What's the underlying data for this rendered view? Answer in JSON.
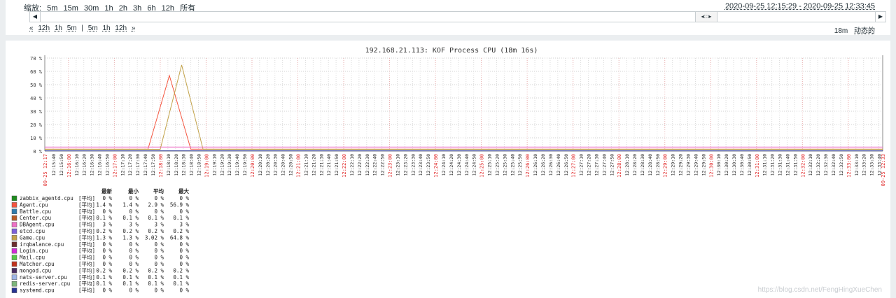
{
  "zoom": {
    "label": "缩放:",
    "options": [
      "5m",
      "15m",
      "30m",
      "1h",
      "2h",
      "3h",
      "6h",
      "12h",
      "所有"
    ]
  },
  "time_range": "2020-09-25 12:15:29 - 2020-09-25 12:33:45",
  "scrollbar": {
    "left_arrow": "◀",
    "right_arrow": "▶",
    "thumb": "◂:::▸"
  },
  "nav": {
    "back_fast": "«",
    "back_items": [
      "12h",
      "1h",
      "5m"
    ],
    "separator": "|",
    "fwd_items": [
      "5m",
      "1h",
      "12h"
    ],
    "fwd_fast": "»"
  },
  "period": {
    "length": "18m",
    "mode": "动态的"
  },
  "graph": {
    "title": "192.168.21.113: KOF Process CPU (18m 16s)",
    "colors": {
      "Agent": "#f4553f",
      "Game": "#c2a24a",
      "baseline": "#1a237e"
    }
  },
  "chart_data": {
    "type": "line",
    "title": "192.168.21.113: KOF Process CPU (18m 16s)",
    "ylim": [
      0,
      70
    ],
    "yticks": [
      "0 %",
      "10 %",
      "20 %",
      "30 %",
      "40 %",
      "50 %",
      "60 %",
      "70 %"
    ],
    "x_start_label": "09-25 12:17",
    "x_end_label": "09-25 12:33",
    "x_time_labels": [
      "12:15:40",
      "12:15:50",
      "12:16:00",
      "12:16:10",
      "12:16:20",
      "12:16:30",
      "12:16:40",
      "12:16:50",
      "12:17:00",
      "12:17:10",
      "12:17:20",
      "12:17:30",
      "12:17:40",
      "12:17:50",
      "12:18:00",
      "12:18:10",
      "12:18:20",
      "12:18:30",
      "12:18:40",
      "12:18:50",
      "12:19:00",
      "12:19:10",
      "12:19:20",
      "12:19:30",
      "12:19:40",
      "12:19:50",
      "12:20:00",
      "12:20:10",
      "12:20:20",
      "12:20:30",
      "12:20:40",
      "12:20:50",
      "12:21:00",
      "12:21:10",
      "12:21:20",
      "12:21:30",
      "12:21:40",
      "12:21:50",
      "12:22:00",
      "12:22:10",
      "12:22:20",
      "12:22:30",
      "12:22:40",
      "12:22:50",
      "12:23:00",
      "12:23:10",
      "12:23:20",
      "12:23:30",
      "12:23:40",
      "12:23:50",
      "12:24:00",
      "12:24:10",
      "12:24:20",
      "12:24:30",
      "12:24:40",
      "12:24:50",
      "12:25:00",
      "12:25:10",
      "12:25:20",
      "12:25:30",
      "12:25:40",
      "12:25:50",
      "12:26:00",
      "12:26:10",
      "12:26:20",
      "12:26:30",
      "12:26:40",
      "12:26:50",
      "12:27:00",
      "12:27:10",
      "12:27:20",
      "12:27:30",
      "12:27:40",
      "12:27:50",
      "12:28:00",
      "12:28:10",
      "12:28:20",
      "12:28:30",
      "12:28:40",
      "12:28:50",
      "12:29:00",
      "12:29:10",
      "12:29:20",
      "12:29:30",
      "12:29:40",
      "12:29:50",
      "12:30:00",
      "12:30:10",
      "12:30:20",
      "12:30:30",
      "12:30:40",
      "12:30:50",
      "12:31:00",
      "12:31:10",
      "12:31:20",
      "12:31:30",
      "12:31:40",
      "12:31:50",
      "12:32:00",
      "12:32:10",
      "12:32:20",
      "12:32:30",
      "12:32:40",
      "12:32:50",
      "12:33:00",
      "12:33:10",
      "12:33:20",
      "12:33:30",
      "12:33:40"
    ],
    "series": [
      {
        "name": "Agent.cpu",
        "color": "#f4553f",
        "points": [
          [
            "12:15:29",
            1.4
          ],
          [
            "12:17:44",
            1.4
          ],
          [
            "12:18:12",
            56.9
          ],
          [
            "12:18:40",
            1.4
          ],
          [
            "12:33:45",
            1.4
          ]
        ]
      },
      {
        "name": "Game.cpu",
        "color": "#c2a24a",
        "points": [
          [
            "12:15:29",
            1.3
          ],
          [
            "12:18:00",
            1.3
          ],
          [
            "12:18:28",
            64.8
          ],
          [
            "12:18:56",
            1.3
          ],
          [
            "12:33:45",
            1.3
          ]
        ]
      },
      {
        "name": "DBAgent.cpu",
        "color": "#ee70c5",
        "points": [
          [
            "12:15:29",
            3
          ],
          [
            "12:33:45",
            3
          ]
        ]
      },
      {
        "name": "systemd.cpu",
        "color": "#283593",
        "points": [
          [
            "12:15:29",
            0.2
          ],
          [
            "12:33:45",
            0.2
          ]
        ]
      }
    ]
  },
  "legend": {
    "headers": [
      "最新",
      "最小",
      "平均",
      "最大"
    ],
    "rows": [
      {
        "name": "zabbix_agentd.cpu",
        "color": "#1e8c1e",
        "func": "[平均]",
        "last": "0 %",
        "min": "0 %",
        "avg": "0 %",
        "max": "0 %"
      },
      {
        "name": "Agent.cpu",
        "color": "#f4553f",
        "func": "[平均]",
        "last": "1.4 %",
        "min": "1.4 %",
        "avg": "2.9 %",
        "max": "56.9 %"
      },
      {
        "name": "Battle.cpu",
        "color": "#2f7dae",
        "func": "[平均]",
        "last": "0 %",
        "min": "0 %",
        "avg": "0 %",
        "max": "0 %"
      },
      {
        "name": "Center.cpu",
        "color": "#b85c27",
        "func": "[平均]",
        "last": "0.1 %",
        "min": "0.1 %",
        "avg": "0.1 %",
        "max": "0.1 %"
      },
      {
        "name": "DBAgent.cpu",
        "color": "#ee70c5",
        "func": "[平均]",
        "last": "3 %",
        "min": "3 %",
        "avg": "3 %",
        "max": "3 %"
      },
      {
        "name": "etcd.cpu",
        "color": "#7b5fd8",
        "func": "[平均]",
        "last": "0.2 %",
        "min": "0.2 %",
        "avg": "0.2 %",
        "max": "0.2 %"
      },
      {
        "name": "Game.cpu",
        "color": "#c2a24a",
        "func": "[平均]",
        "last": "1.3 %",
        "min": "1.3 %",
        "avg": "3.02 %",
        "max": "64.8 %"
      },
      {
        "name": "irqbalance.cpu",
        "color": "#6b2f2f",
        "func": "[平均]",
        "last": "0 %",
        "min": "0 %",
        "avg": "0 %",
        "max": "0 %"
      },
      {
        "name": "Login.cpu",
        "color": "#d22ad6",
        "func": "[平均]",
        "last": "0 %",
        "min": "0 %",
        "avg": "0 %",
        "max": "0 %"
      },
      {
        "name": "Mail.cpu",
        "color": "#55c947",
        "func": "[平均]",
        "last": "0 %",
        "min": "0 %",
        "avg": "0 %",
        "max": "0 %"
      },
      {
        "name": "Matcher.cpu",
        "color": "#c1331c",
        "func": "[平均]",
        "last": "0 %",
        "min": "0 %",
        "avg": "0 %",
        "max": "0 %"
      },
      {
        "name": "mongod.cpu",
        "color": "#4a2f63",
        "func": "[平均]",
        "last": "0.2 %",
        "min": "0.2 %",
        "avg": "0.2 %",
        "max": "0.2 %"
      },
      {
        "name": "nats-server.cpu",
        "color": "#9fb6e6",
        "func": "[平均]",
        "last": "0.1 %",
        "min": "0.1 %",
        "avg": "0.1 %",
        "max": "0.1 %"
      },
      {
        "name": "redis-server.cpu",
        "color": "#7db57b",
        "func": "[平均]",
        "last": "0.1 %",
        "min": "0.1 %",
        "avg": "0.1 %",
        "max": "0.1 %"
      },
      {
        "name": "systemd.cpu",
        "color": "#283593",
        "func": "[平均]",
        "last": "0 %",
        "min": "0 %",
        "avg": "0 %",
        "max": "0 %"
      }
    ]
  },
  "watermark": "https://blog.csdn.net/FengHingXueChen"
}
